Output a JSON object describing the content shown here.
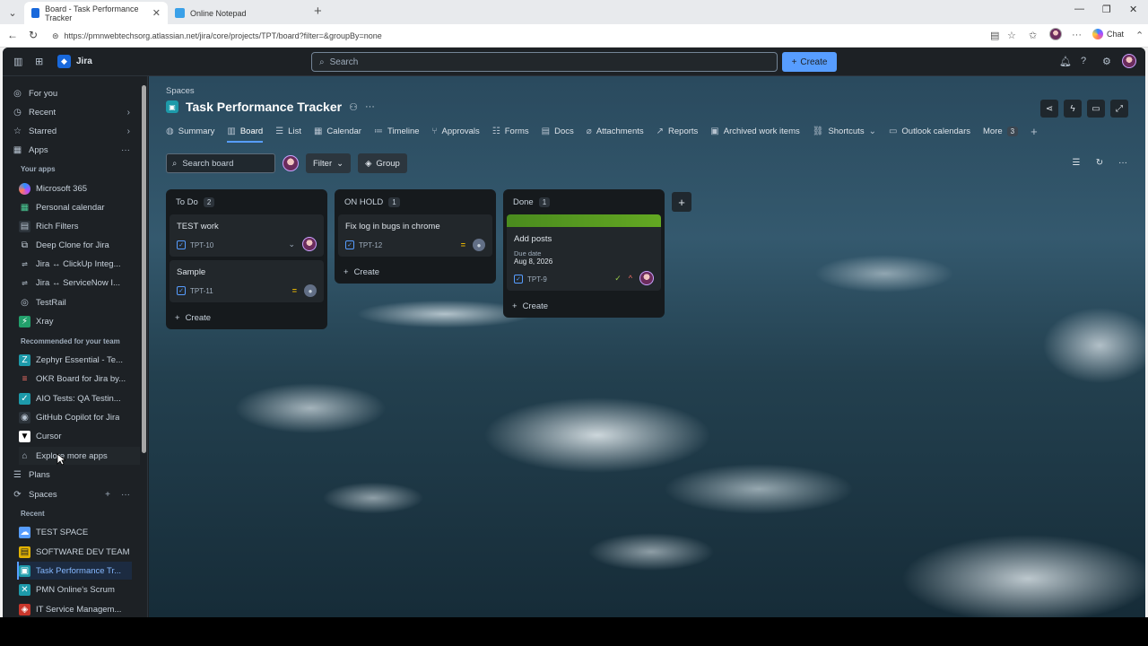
{
  "browser": {
    "tabs": [
      {
        "title": "Board - Task Performance Tracker",
        "active": true
      },
      {
        "title": "Online Notepad",
        "active": false
      }
    ],
    "url": "https://pmnwebtechsorg.atlassian.net/jira/core/projects/TPT/board?filter=&groupBy=none",
    "chat_label": "Chat"
  },
  "topnav": {
    "app_name": "Jira",
    "search_placeholder": "Search",
    "create_label": "Create"
  },
  "sidebar": {
    "items_top": [
      {
        "label": "For you",
        "icon": "user-circle-icon"
      },
      {
        "label": "Recent",
        "icon": "clock-icon"
      },
      {
        "label": "Starred",
        "icon": "star-icon"
      },
      {
        "label": "Apps",
        "icon": "apps-icon"
      }
    ],
    "your_apps_heading": "Your apps",
    "your_apps": [
      "Microsoft 365",
      "Personal calendar",
      "Rich Filters",
      "Deep Clone for Jira",
      "Jira ↔ ClickUp Integ...",
      "Jira ↔ ServiceNow I...",
      "TestRail",
      "Xray"
    ],
    "recommended_heading": "Recommended for your team",
    "recommended": [
      "Zephyr Essential - Te...",
      "OKR Board for Jira by...",
      "AIO Tests: QA Testin...",
      "GitHub Copilot for Jira",
      "Cursor",
      "Explore more apps"
    ],
    "plans_label": "Plans",
    "spaces_label": "Spaces",
    "recent_heading": "Recent",
    "recent_spaces": [
      "TEST SPACE",
      "SOFTWARE DEV TEAM",
      "Task Performance Tr...",
      "PMN Online's Scrum",
      "IT Service Managem..."
    ]
  },
  "main": {
    "breadcrumb": "Spaces",
    "project_title": "Task Performance Tracker",
    "tabs": [
      {
        "label": "Summary",
        "icon": "globe-icon"
      },
      {
        "label": "Board",
        "icon": "board-icon",
        "active": true
      },
      {
        "label": "List",
        "icon": "list-icon"
      },
      {
        "label": "Calendar",
        "icon": "calendar-icon"
      },
      {
        "label": "Timeline",
        "icon": "timeline-icon"
      },
      {
        "label": "Approvals",
        "icon": "approvals-icon"
      },
      {
        "label": "Forms",
        "icon": "forms-icon"
      },
      {
        "label": "Docs",
        "icon": "docs-icon"
      },
      {
        "label": "Attachments",
        "icon": "paperclip-icon"
      },
      {
        "label": "Reports",
        "icon": "chart-icon"
      },
      {
        "label": "Archived work items",
        "icon": "archive-icon"
      },
      {
        "label": "Shortcuts",
        "icon": "link-icon"
      },
      {
        "label": "Outlook calendars",
        "icon": "outlook-icon"
      }
    ],
    "more_label": "More",
    "more_count": "3",
    "search_board_placeholder": "Search board",
    "filter_label": "Filter",
    "group_label": "Group"
  },
  "board": {
    "columns": [
      {
        "name": "To Do",
        "count": "2",
        "cards": [
          {
            "title": "TEST work",
            "key": "TPT-10"
          },
          {
            "title": "Sample",
            "key": "TPT-11"
          }
        ]
      },
      {
        "name": "ON HOLD",
        "count": "1",
        "cards": [
          {
            "title": "Fix log in bugs in chrome",
            "key": "TPT-12"
          }
        ]
      },
      {
        "name": "Done",
        "count": "1",
        "cards": [
          {
            "title": "Add posts",
            "key": "TPT-9",
            "due_label": "Due date",
            "due_value": "Aug 8, 2026",
            "cover_color": "#5a9e1f"
          }
        ]
      }
    ],
    "create_label": "Create"
  }
}
